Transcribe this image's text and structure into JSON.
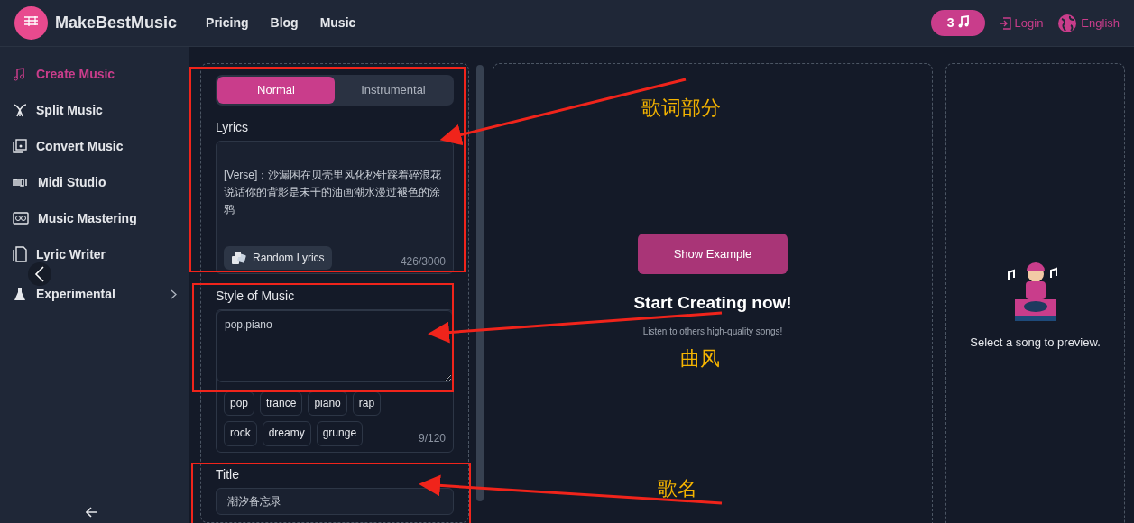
{
  "navbar": {
    "brand": "MakeBestMusic",
    "links": [
      "Pricing",
      "Blog",
      "Music"
    ],
    "credits": "3",
    "login": "Login",
    "language": "English"
  },
  "sidebar": {
    "items": [
      {
        "label": "Create Music",
        "selected": true,
        "kind": "link"
      },
      {
        "label": "Split Music",
        "selected": false,
        "kind": "link"
      },
      {
        "label": "Convert Music",
        "selected": false,
        "kind": "link"
      },
      {
        "label": "Midi Studio",
        "selected": false,
        "kind": "link"
      },
      {
        "label": "Music Mastering",
        "selected": false,
        "kind": "link"
      },
      {
        "label": "Lyric Writer",
        "selected": false,
        "kind": "link"
      },
      {
        "label": "Experimental",
        "selected": false,
        "kind": "submenu"
      }
    ]
  },
  "form": {
    "modes": [
      {
        "label": "Normal",
        "selected": true
      },
      {
        "label": "Instrumental",
        "selected": false
      }
    ],
    "lyrics": {
      "label": "Lyrics",
      "value": "[Verse]：沙漏困在贝壳里风化秒针踩着碎浪花说话你的背影是未干的油画潮水漫过褪色的涂鸦",
      "random_button": "Random Lyrics",
      "counter": "426/3000"
    },
    "style": {
      "label": "Style of Music",
      "value": "pop,piano",
      "tags": [
        "pop",
        "trance",
        "piano",
        "rap",
        "rock",
        "dreamy",
        "grunge"
      ],
      "counter": "9/120"
    },
    "title": {
      "label": "Title",
      "value": "潮汐备忘录"
    }
  },
  "preview": {
    "button": "Show Example",
    "heading": "Start Creating now!",
    "subtitle": "Listen to others high-quality songs!"
  },
  "player": {
    "empty_text": "Select a song to preview."
  },
  "annotations": [
    {
      "text": "歌词部分"
    },
    {
      "text": "曲风"
    },
    {
      "text": "歌名"
    }
  ]
}
